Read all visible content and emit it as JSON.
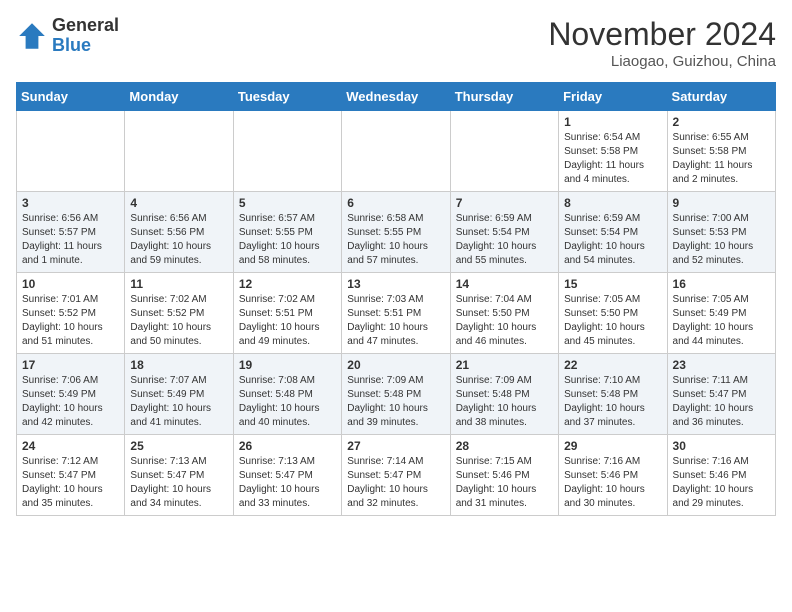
{
  "logo": {
    "general": "General",
    "blue": "Blue"
  },
  "title": "November 2024",
  "location": "Liaogao, Guizhou, China",
  "weekdays": [
    "Sunday",
    "Monday",
    "Tuesday",
    "Wednesday",
    "Thursday",
    "Friday",
    "Saturday"
  ],
  "weeks": [
    [
      {
        "day": "",
        "info": ""
      },
      {
        "day": "",
        "info": ""
      },
      {
        "day": "",
        "info": ""
      },
      {
        "day": "",
        "info": ""
      },
      {
        "day": "",
        "info": ""
      },
      {
        "day": "1",
        "info": "Sunrise: 6:54 AM\nSunset: 5:58 PM\nDaylight: 11 hours\nand 4 minutes."
      },
      {
        "day": "2",
        "info": "Sunrise: 6:55 AM\nSunset: 5:58 PM\nDaylight: 11 hours\nand 2 minutes."
      }
    ],
    [
      {
        "day": "3",
        "info": "Sunrise: 6:56 AM\nSunset: 5:57 PM\nDaylight: 11 hours\nand 1 minute."
      },
      {
        "day": "4",
        "info": "Sunrise: 6:56 AM\nSunset: 5:56 PM\nDaylight: 10 hours\nand 59 minutes."
      },
      {
        "day": "5",
        "info": "Sunrise: 6:57 AM\nSunset: 5:55 PM\nDaylight: 10 hours\nand 58 minutes."
      },
      {
        "day": "6",
        "info": "Sunrise: 6:58 AM\nSunset: 5:55 PM\nDaylight: 10 hours\nand 57 minutes."
      },
      {
        "day": "7",
        "info": "Sunrise: 6:59 AM\nSunset: 5:54 PM\nDaylight: 10 hours\nand 55 minutes."
      },
      {
        "day": "8",
        "info": "Sunrise: 6:59 AM\nSunset: 5:54 PM\nDaylight: 10 hours\nand 54 minutes."
      },
      {
        "day": "9",
        "info": "Sunrise: 7:00 AM\nSunset: 5:53 PM\nDaylight: 10 hours\nand 52 minutes."
      }
    ],
    [
      {
        "day": "10",
        "info": "Sunrise: 7:01 AM\nSunset: 5:52 PM\nDaylight: 10 hours\nand 51 minutes."
      },
      {
        "day": "11",
        "info": "Sunrise: 7:02 AM\nSunset: 5:52 PM\nDaylight: 10 hours\nand 50 minutes."
      },
      {
        "day": "12",
        "info": "Sunrise: 7:02 AM\nSunset: 5:51 PM\nDaylight: 10 hours\nand 49 minutes."
      },
      {
        "day": "13",
        "info": "Sunrise: 7:03 AM\nSunset: 5:51 PM\nDaylight: 10 hours\nand 47 minutes."
      },
      {
        "day": "14",
        "info": "Sunrise: 7:04 AM\nSunset: 5:50 PM\nDaylight: 10 hours\nand 46 minutes."
      },
      {
        "day": "15",
        "info": "Sunrise: 7:05 AM\nSunset: 5:50 PM\nDaylight: 10 hours\nand 45 minutes."
      },
      {
        "day": "16",
        "info": "Sunrise: 7:05 AM\nSunset: 5:49 PM\nDaylight: 10 hours\nand 44 minutes."
      }
    ],
    [
      {
        "day": "17",
        "info": "Sunrise: 7:06 AM\nSunset: 5:49 PM\nDaylight: 10 hours\nand 42 minutes."
      },
      {
        "day": "18",
        "info": "Sunrise: 7:07 AM\nSunset: 5:49 PM\nDaylight: 10 hours\nand 41 minutes."
      },
      {
        "day": "19",
        "info": "Sunrise: 7:08 AM\nSunset: 5:48 PM\nDaylight: 10 hours\nand 40 minutes."
      },
      {
        "day": "20",
        "info": "Sunrise: 7:09 AM\nSunset: 5:48 PM\nDaylight: 10 hours\nand 39 minutes."
      },
      {
        "day": "21",
        "info": "Sunrise: 7:09 AM\nSunset: 5:48 PM\nDaylight: 10 hours\nand 38 minutes."
      },
      {
        "day": "22",
        "info": "Sunrise: 7:10 AM\nSunset: 5:48 PM\nDaylight: 10 hours\nand 37 minutes."
      },
      {
        "day": "23",
        "info": "Sunrise: 7:11 AM\nSunset: 5:47 PM\nDaylight: 10 hours\nand 36 minutes."
      }
    ],
    [
      {
        "day": "24",
        "info": "Sunrise: 7:12 AM\nSunset: 5:47 PM\nDaylight: 10 hours\nand 35 minutes."
      },
      {
        "day": "25",
        "info": "Sunrise: 7:13 AM\nSunset: 5:47 PM\nDaylight: 10 hours\nand 34 minutes."
      },
      {
        "day": "26",
        "info": "Sunrise: 7:13 AM\nSunset: 5:47 PM\nDaylight: 10 hours\nand 33 minutes."
      },
      {
        "day": "27",
        "info": "Sunrise: 7:14 AM\nSunset: 5:47 PM\nDaylight: 10 hours\nand 32 minutes."
      },
      {
        "day": "28",
        "info": "Sunrise: 7:15 AM\nSunset: 5:46 PM\nDaylight: 10 hours\nand 31 minutes."
      },
      {
        "day": "29",
        "info": "Sunrise: 7:16 AM\nSunset: 5:46 PM\nDaylight: 10 hours\nand 30 minutes."
      },
      {
        "day": "30",
        "info": "Sunrise: 7:16 AM\nSunset: 5:46 PM\nDaylight: 10 hours\nand 29 minutes."
      }
    ]
  ]
}
